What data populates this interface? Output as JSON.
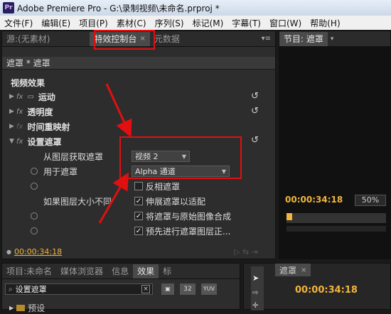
{
  "window": {
    "title": "Adobe Premiere Pro - G:\\录制视频\\未命名.prproj *",
    "app_icon": "Pr"
  },
  "menu": [
    "文件(F)",
    "编辑(E)",
    "项目(P)",
    "素材(C)",
    "序列(S)",
    "标记(M)",
    "字幕(T)",
    "窗口(W)",
    "帮助(H)"
  ],
  "left_tabs": {
    "source": "源:(无素材)",
    "effects_control": "特效控制台",
    "metadata": "元数据"
  },
  "effect_header": "遮罩 * 遮罩",
  "video_effects_label": "视频效果",
  "effects": [
    {
      "name": "运动"
    },
    {
      "name": "透明度"
    },
    {
      "name": "时间重映射"
    },
    {
      "name": "设置遮罩"
    }
  ],
  "props": {
    "source_layer_label": "从图层获取遮罩",
    "source_layer_value": "视频 2",
    "use_for_label": "用于遮罩",
    "use_for_value": "Alpha 通道",
    "invert_label": "反相遮罩",
    "size_diff_label": "如果图层大小不同",
    "stretch_label": "伸展遮罩以适配",
    "composite_label": "将遮罩与原始图像合成",
    "premultiply_label": "预先进行遮罩图层正..."
  },
  "left_timecode": "00:00:34:18",
  "right_tabs": {
    "program": "节目: 遮罩"
  },
  "right_timecode": "00:00:34:18",
  "zoom": "50%",
  "bottom_tabs": {
    "project": "项目:未命名",
    "media_browser": "媒体浏览器",
    "info": "信息",
    "effects": "效果",
    "more": "标"
  },
  "search_value": "设置遮罩",
  "bin_badges": {
    "b32": "32",
    "yuv": "YUV"
  },
  "preset_label": "预设",
  "sequence_tab": "遮罩",
  "sequence_timecode": "00:00:34:18"
}
